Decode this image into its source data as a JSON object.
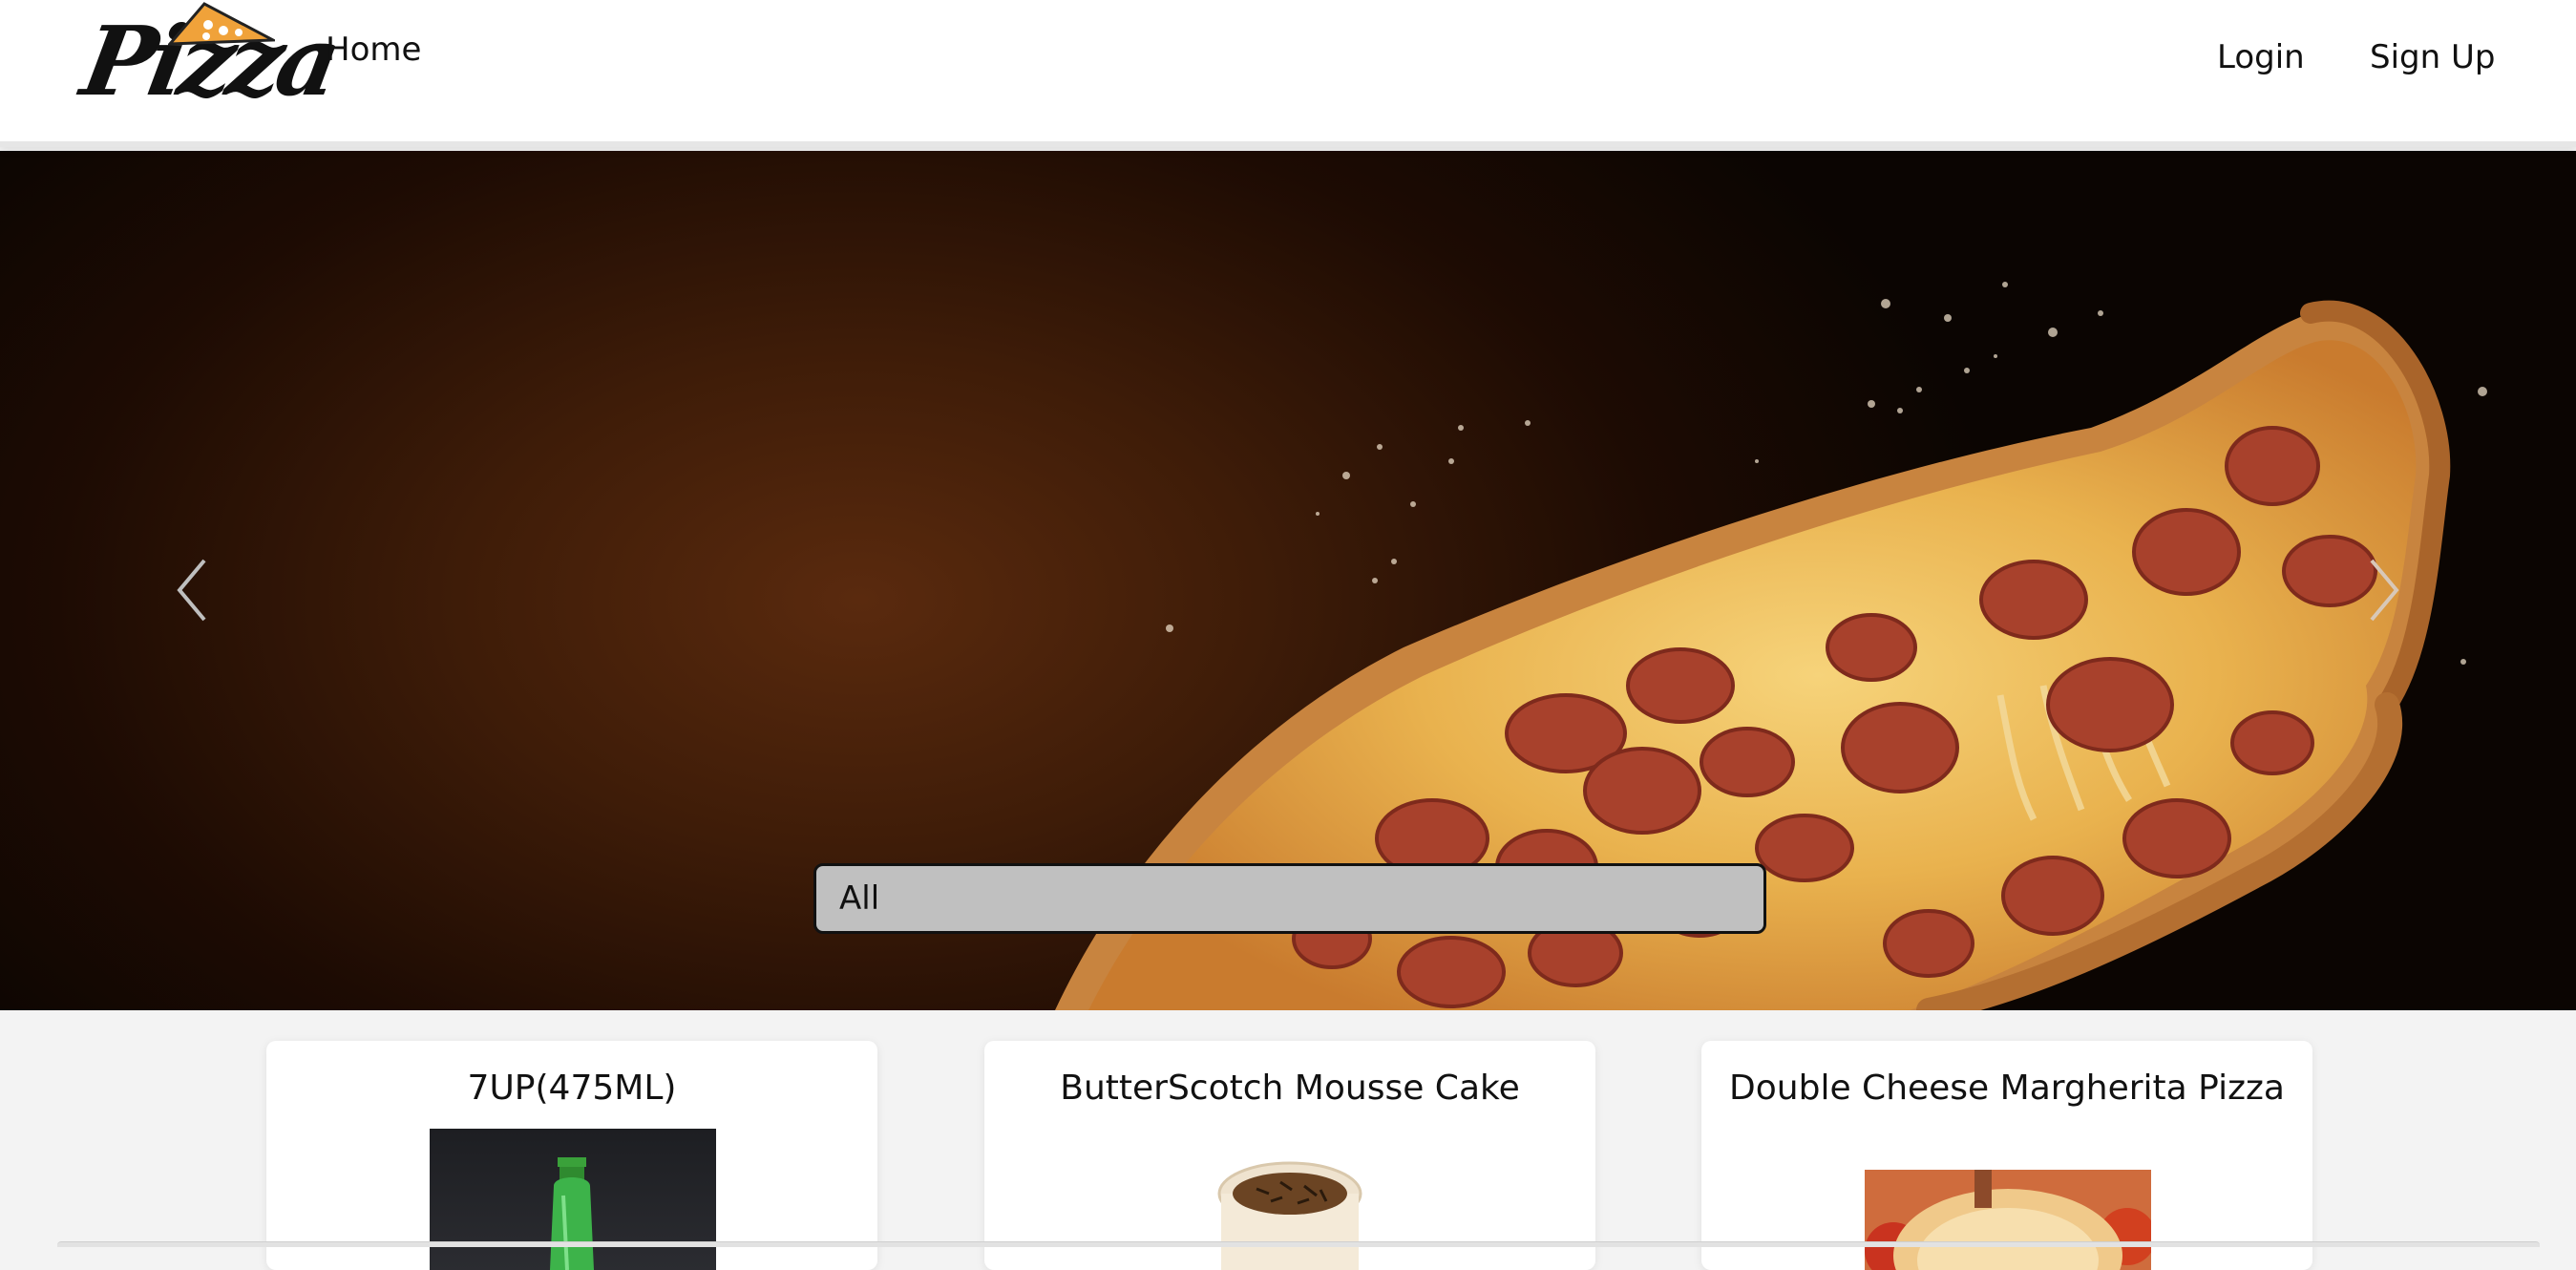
{
  "navbar": {
    "logo_text": "Pizza",
    "home_label": "Home",
    "login_label": "Login",
    "signup_label": "Sign Up"
  },
  "hero": {
    "prev_icon": "chevron-left-icon",
    "next_icon": "chevron-right-icon"
  },
  "filter": {
    "selected_category": "All"
  },
  "products": [
    {
      "name": "7UP(475ML)"
    },
    {
      "name": "ButterScotch Mousse Cake"
    },
    {
      "name": "Double Cheese Margherita Pizza"
    }
  ],
  "colors": {
    "accent_orange": "#f0a23a",
    "hero_dark": "#1d0b03",
    "select_bg": "#c0c0c0"
  }
}
